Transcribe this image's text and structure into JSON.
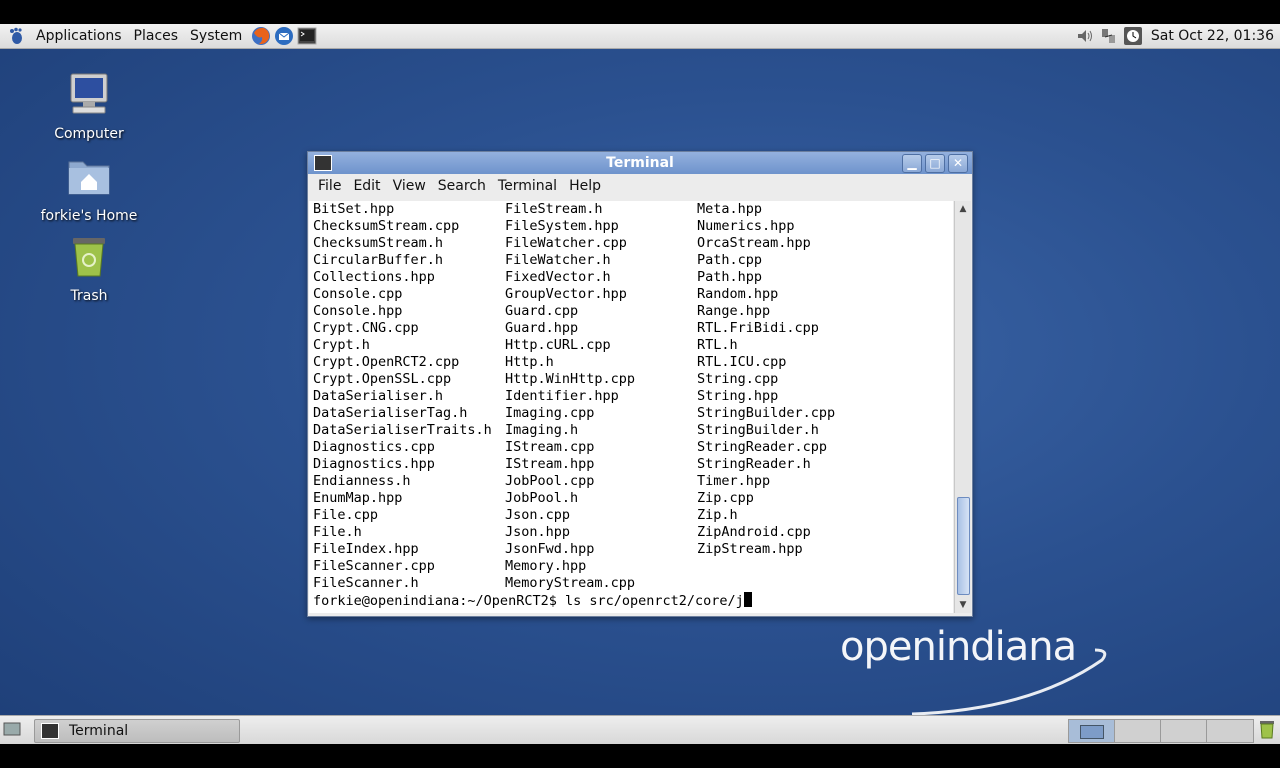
{
  "top_panel": {
    "menus": [
      "Applications",
      "Places",
      "System"
    ],
    "clock": "Sat Oct 22, 01:36"
  },
  "desktop": {
    "icons": [
      {
        "label": "Computer",
        "icon": "computer-icon"
      },
      {
        "label": "forkie's Home",
        "icon": "home-folder-icon"
      },
      {
        "label": "Trash",
        "icon": "trash-icon"
      }
    ],
    "brand": "openindiana"
  },
  "terminal": {
    "title": "Terminal",
    "menus": [
      "File",
      "Edit",
      "View",
      "Search",
      "Terminal",
      "Help"
    ],
    "columns": [
      [
        "BitSet.hpp",
        "ChecksumStream.cpp",
        "ChecksumStream.h",
        "CircularBuffer.h",
        "Collections.hpp",
        "Console.cpp",
        "Console.hpp",
        "Crypt.CNG.cpp",
        "Crypt.h",
        "Crypt.OpenRCT2.cpp",
        "Crypt.OpenSSL.cpp",
        "DataSerialiser.h",
        "DataSerialiserTag.h",
        "DataSerialiserTraits.h",
        "Diagnostics.cpp",
        "Diagnostics.hpp",
        "Endianness.h",
        "EnumMap.hpp",
        "File.cpp",
        "File.h",
        "FileIndex.hpp",
        "FileScanner.cpp",
        "FileScanner.h"
      ],
      [
        "FileStream.h",
        "FileSystem.hpp",
        "FileWatcher.cpp",
        "FileWatcher.h",
        "FixedVector.h",
        "GroupVector.hpp",
        "Guard.cpp",
        "Guard.hpp",
        "Http.cURL.cpp",
        "Http.h",
        "Http.WinHttp.cpp",
        "Identifier.hpp",
        "Imaging.cpp",
        "Imaging.h",
        "IStream.cpp",
        "IStream.hpp",
        "JobPool.cpp",
        "JobPool.h",
        "Json.cpp",
        "Json.hpp",
        "JsonFwd.hpp",
        "Memory.hpp",
        "MemoryStream.cpp"
      ],
      [
        "Meta.hpp",
        "Numerics.hpp",
        "OrcaStream.hpp",
        "Path.cpp",
        "Path.hpp",
        "Random.hpp",
        "Range.hpp",
        "RTL.FriBidi.cpp",
        "RTL.h",
        "RTL.ICU.cpp",
        "String.cpp",
        "String.hpp",
        "StringBuilder.cpp",
        "StringBuilder.h",
        "StringReader.cpp",
        "StringReader.h",
        "Timer.hpp",
        "Zip.cpp",
        "Zip.h",
        "ZipAndroid.cpp",
        "ZipStream.hpp"
      ]
    ],
    "prompt": "forkie@openindiana:~/OpenRCT2$ ls src/openrct2/core/j"
  },
  "bottom_panel": {
    "task_label": "Terminal"
  }
}
